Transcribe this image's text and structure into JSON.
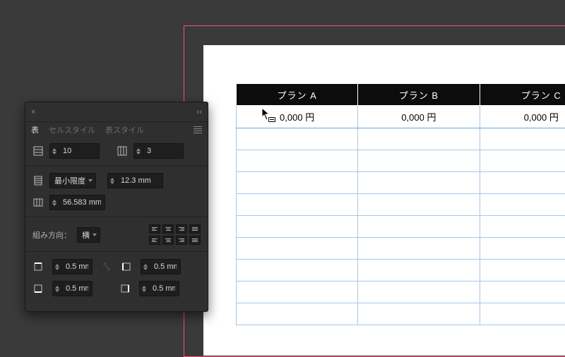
{
  "panel": {
    "tabs": {
      "table": "表",
      "cell_style": "セルスタイル",
      "table_style": "表スタイル"
    },
    "rows_value": "10",
    "cols_value": "3",
    "height_mode": "最小限度",
    "row_height": "12.3 mm",
    "col_width": "56.583 mm",
    "direction_label": "組み方向：",
    "direction_value": "横",
    "inset_top": "0.5 mm",
    "inset_bottom": "0.5 mm",
    "inset_left": "0.5 mm",
    "inset_right": "0.5 mm"
  },
  "doc": {
    "headers": {
      "a": "プラン A",
      "b": "プラン B",
      "c": "プラン C"
    },
    "price": {
      "a": "0,000 円",
      "b": "0,000 円",
      "c": "0,000 円"
    }
  }
}
